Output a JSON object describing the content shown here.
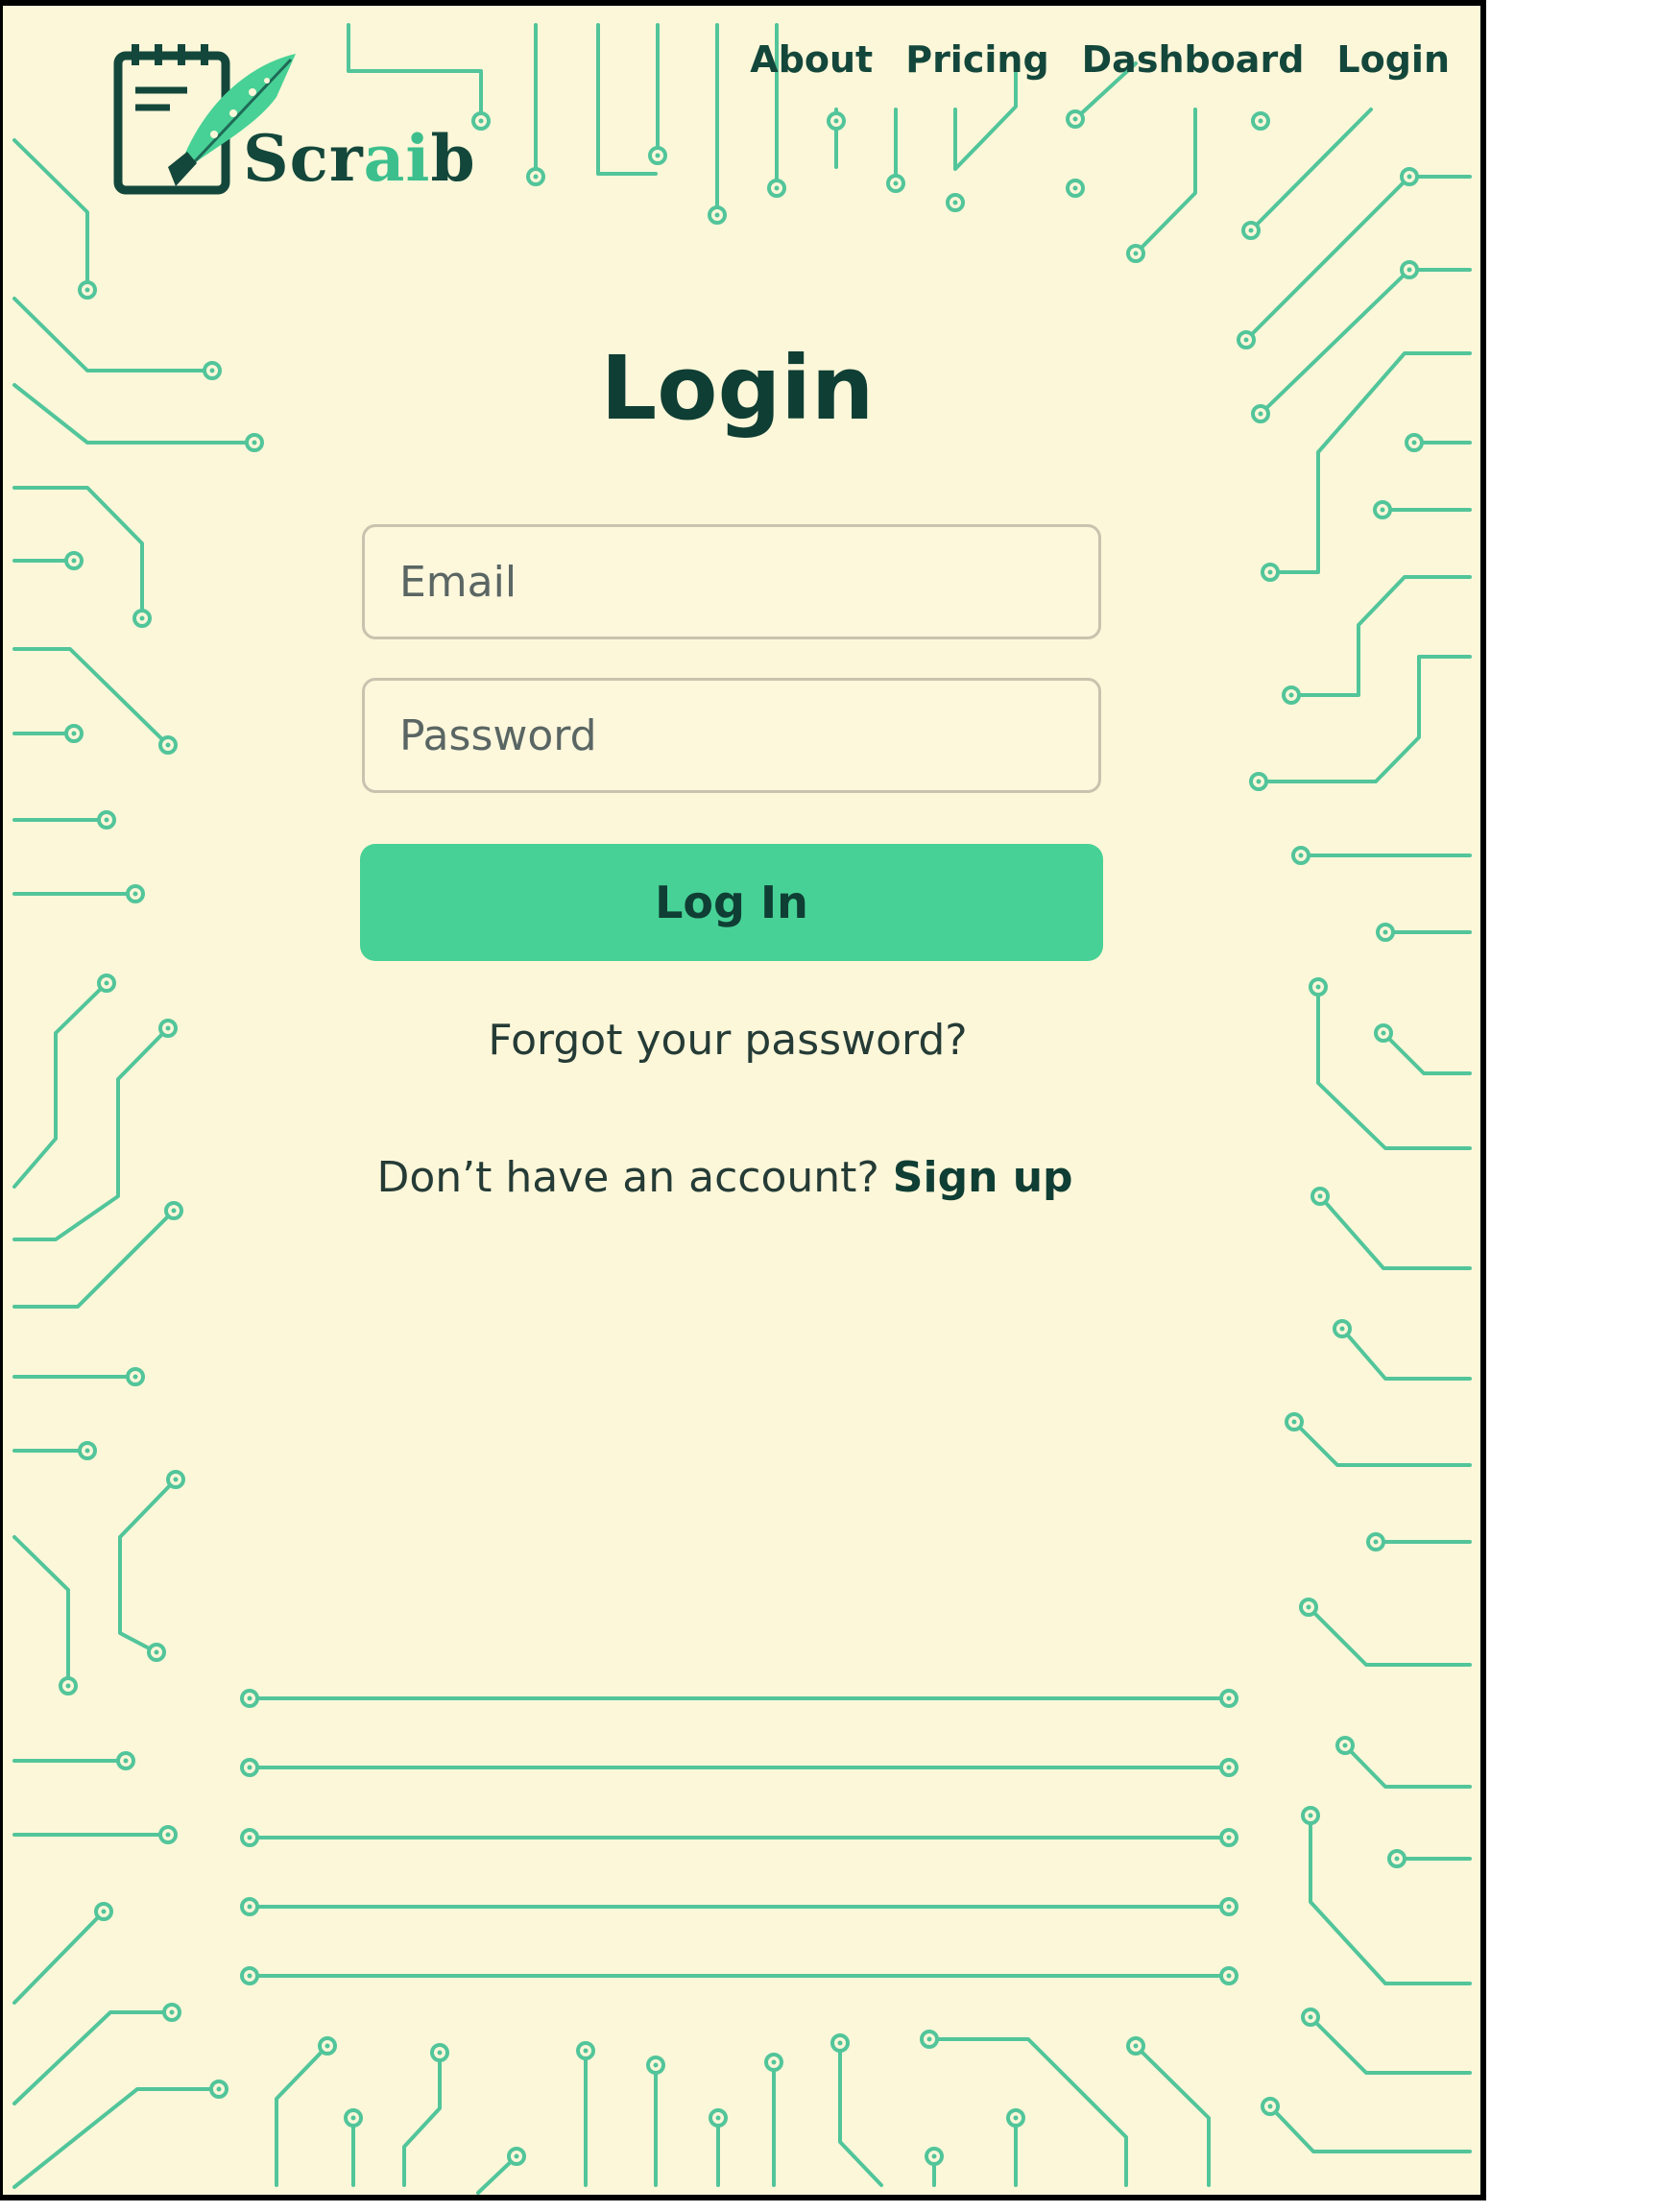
{
  "brand": {
    "name_prefix": "Scr",
    "name_highlight": "ai",
    "name_suffix": "b"
  },
  "nav": {
    "items": [
      "About",
      "Pricing",
      "Dashboard",
      "Login"
    ]
  },
  "login": {
    "title": "Login",
    "email_placeholder": "Email",
    "password_placeholder": "Password",
    "submit_label": "Log In",
    "forgot_link": "Forgot your password?",
    "signup_prompt": "Don’t have an account?",
    "signup_link": "Sign up"
  },
  "colors": {
    "background": "#fdf7d9",
    "accent": "#47d196",
    "text_dark": "#0f3e34",
    "circuit": "#52c59a"
  },
  "icons": [
    "calendar-notepad-icon",
    "quill-pen-icon",
    "circuit-background"
  ]
}
